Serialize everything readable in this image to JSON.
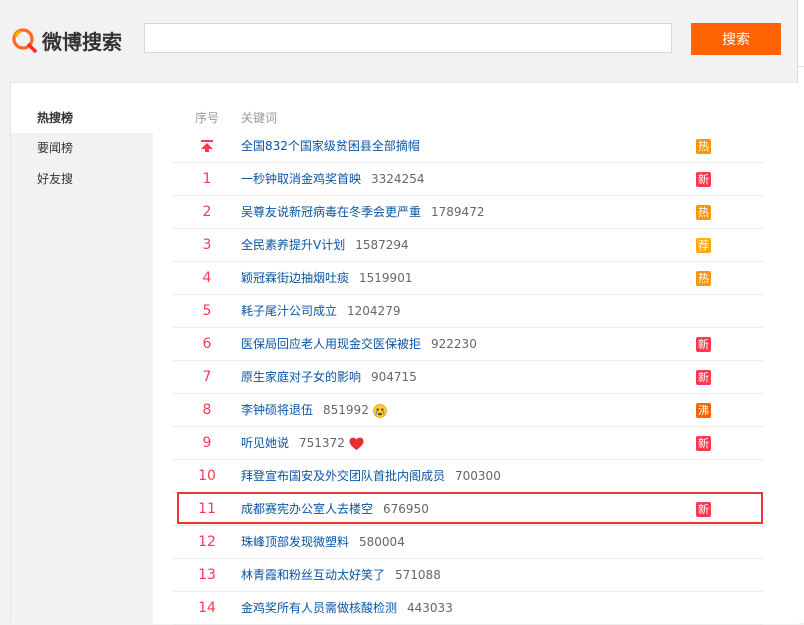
{
  "header": {
    "logo_text": "微博搜索",
    "search_value": "",
    "search_button_label": "搜索"
  },
  "sidebar": {
    "items": [
      {
        "label": "热搜榜",
        "active": true
      },
      {
        "label": "要闻榜",
        "active": false
      },
      {
        "label": "好友搜",
        "active": false
      }
    ]
  },
  "table": {
    "col_rank": "序号",
    "col_keyword": "关键词",
    "rows": [
      {
        "rank": "",
        "pinned": true,
        "keyword": "全国832个国家级贫困县全部摘帽",
        "count": "",
        "badge": "热",
        "badge_color": "#ff9406"
      },
      {
        "rank": "1",
        "keyword": "一秒钟取消金鸡奖首映",
        "count": "3324254",
        "badge": "新",
        "badge_color": "#ff3852"
      },
      {
        "rank": "2",
        "keyword": "吴尊友说新冠病毒在冬季会更严重",
        "count": "1789472",
        "badge": "热",
        "badge_color": "#ff9406"
      },
      {
        "rank": "3",
        "keyword": "全民素养提升V计划",
        "count": "1587294",
        "badge": "荐",
        "badge_color": "#ffab0a"
      },
      {
        "rank": "4",
        "keyword": "颖冠霖街边抽烟吐痰",
        "count": "1519901",
        "badge": "热",
        "badge_color": "#ff9406"
      },
      {
        "rank": "5",
        "keyword": "耗子尾汁公司成立",
        "count": "1204279",
        "badge": "",
        "badge_color": ""
      },
      {
        "rank": "6",
        "keyword": "医保局回应老人用现金交医保被拒",
        "count": "922230",
        "badge": "新",
        "badge_color": "#ff3852"
      },
      {
        "rank": "7",
        "keyword": "原生家庭对子女的影响",
        "count": "904715",
        "badge": "新",
        "badge_color": "#ff3852"
      },
      {
        "rank": "8",
        "keyword": "李钟硕将退伍",
        "count": "851992",
        "emoji": "cry-face-icon",
        "badge": "沸",
        "badge_color": "#f86400"
      },
      {
        "rank": "9",
        "keyword": "听见她说",
        "count": "751372",
        "emoji": "heart-icon",
        "badge": "新",
        "badge_color": "#ff3852"
      },
      {
        "rank": "10",
        "keyword": "拜登宣布国安及外交团队首批内阁成员",
        "count": "700300",
        "badge": "",
        "badge_color": ""
      },
      {
        "rank": "11",
        "keyword": "成都赛宪办公室人去楼空",
        "count": "676950",
        "badge": "新",
        "badge_color": "#ff3852"
      },
      {
        "rank": "12",
        "keyword": "珠峰顶部发现微塑料",
        "count": "580004",
        "badge": "",
        "badge_color": ""
      },
      {
        "rank": "13",
        "keyword": "林青霞和粉丝互动太好笑了",
        "count": "571088",
        "badge": "",
        "badge_color": ""
      },
      {
        "rank": "14",
        "keyword": "金鸡奖所有人员需做核酸检测",
        "count": "443033",
        "badge": "",
        "badge_color": ""
      }
    ]
  }
}
